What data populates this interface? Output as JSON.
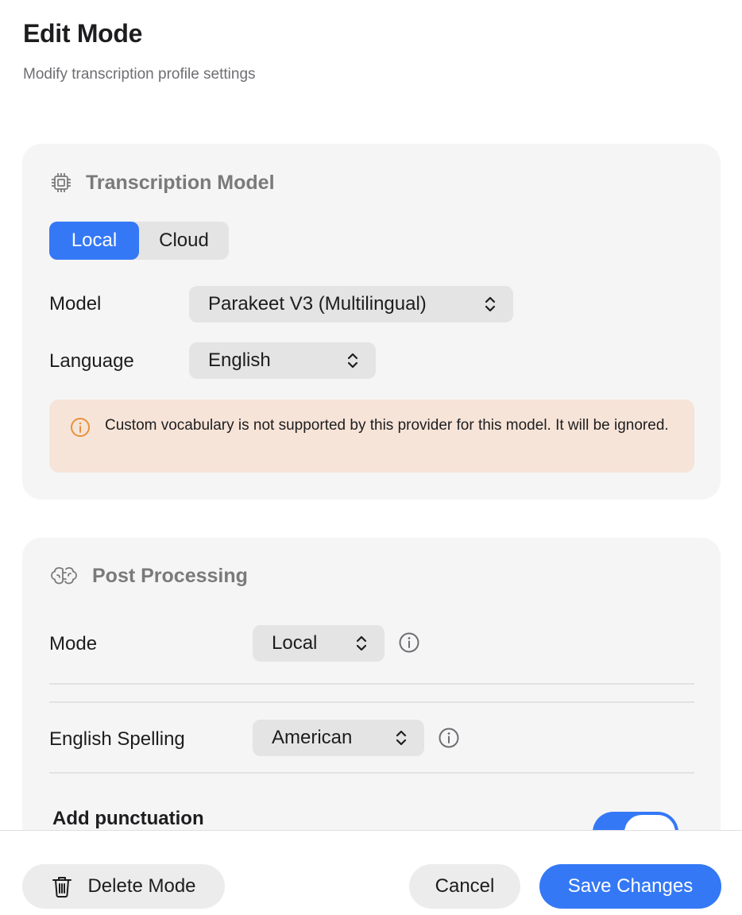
{
  "header": {
    "title": "Edit Mode",
    "subtitle": "Modify transcription profile settings"
  },
  "transcription": {
    "title": "Transcription Model",
    "icon": "cpu-chip-icon",
    "segments": [
      "Local",
      "Cloud"
    ],
    "selected_segment": "Local",
    "model_label": "Model",
    "model_value": "Parakeet V3 (Multilingual)",
    "language_label": "Language",
    "language_value": "English",
    "warning_text": "Custom vocabulary is not supported by this provider for this model. It will be ignored."
  },
  "post_processing": {
    "title": "Post Processing",
    "icon": "brain-icon",
    "mode_label": "Mode",
    "mode_value": "Local",
    "spelling_label": "English Spelling",
    "spelling_value": "American",
    "punctuation_label": "Add punctuation",
    "punctuation_enabled": true
  },
  "footer": {
    "delete_label": "Delete Mode",
    "cancel_label": "Cancel",
    "save_label": "Save Changes"
  },
  "colors": {
    "accent": "#3478f6",
    "warning_bg": "#f7e4d8",
    "warning_icon": "#e8913a",
    "card_bg": "#f5f5f5"
  }
}
